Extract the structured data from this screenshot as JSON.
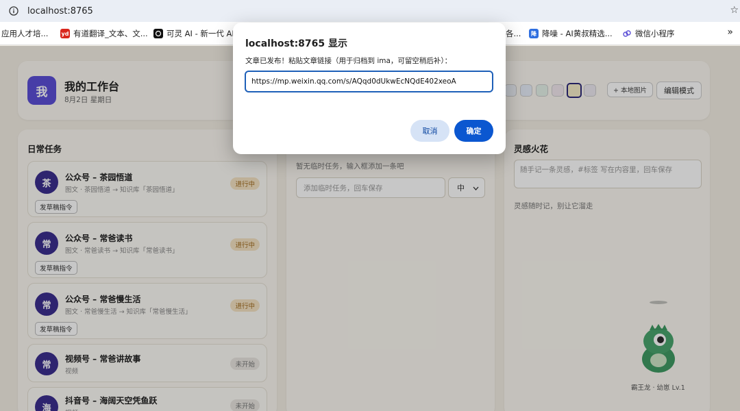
{
  "browser": {
    "url": "localhost:8765",
    "bookmarks": [
      {
        "label": "应用人才培...",
        "icon": "none"
      },
      {
        "label": "有道翻译_文本、文...",
        "icon": "youdao-icon",
        "badge": "yd"
      },
      {
        "label": "可灵 AI - 新一代 AI...",
        "icon": "kling-icon"
      },
      {
        "label": "各...",
        "icon": "none"
      },
      {
        "label": "降噪 - AI黄叔精选...",
        "icon": "jiangzao-icon",
        "badge": "降"
      },
      {
        "label": "微信小程序",
        "icon": "miniprogram-icon"
      }
    ],
    "more": "»"
  },
  "header": {
    "logo": "我",
    "title": "我的工作台",
    "date": "8月2日 星期日",
    "swatches": [
      "#eef1f8",
      "#e7eef9",
      "#e6f2ea",
      "#f2e8ef",
      "#f6edc9",
      "#eeeaf1"
    ],
    "local_image": "+ 本地图片",
    "edit_mode": "编辑模式"
  },
  "daily": {
    "title": "日常任务",
    "tasks": [
      {
        "avatar": "茶",
        "title": "公众号 – 茶园悟道",
        "sub": "图文 · 茶园悟道 → 知识库「茶园悟道」",
        "status": "进行中",
        "status_type": "doing",
        "cmd": "发草稿指令"
      },
      {
        "avatar": "常",
        "title": "公众号 – 常爸读书",
        "sub": "图文 · 常爸读书 → 知识库「常爸读书」",
        "status": "进行中",
        "status_type": "doing",
        "cmd": "发草稿指令"
      },
      {
        "avatar": "常",
        "title": "公众号 – 常爸慢生活",
        "sub": "图文 · 常爸慢生活 → 知识库「常爸慢生活」",
        "status": "进行中",
        "status_type": "doing",
        "cmd": "发草稿指令"
      },
      {
        "avatar": "常",
        "title": "视频号 – 常爸讲故事",
        "sub": "视频",
        "status": "未开始",
        "status_type": "todo",
        "cmd": ""
      },
      {
        "avatar": "海",
        "title": "抖音号 – 海阔天空凭鱼跃",
        "sub": "视频",
        "status": "未开始",
        "status_type": "todo",
        "cmd": ""
      }
    ]
  },
  "temp": {
    "empty": "暂无临时任务，输入框添加一条吧",
    "input_placeholder": "添加临时任务，回车保存",
    "priority": "中"
  },
  "spark": {
    "title": "灵感火花",
    "input_placeholder": "随手记一条灵感，#标签 写在内容里，回车保存",
    "empty": "灵感随时记，别让它溜走"
  },
  "pet": {
    "label": "霸王龙 · 幼崽 Lv.1",
    "color": "#3f9a63"
  },
  "dialog": {
    "title": "localhost:8765 显示",
    "message": "文章已发布！粘贴文章链接（用于归档到 ima，可留空稍后补）：",
    "value": "https://mp.weixin.qq.com/s/AQqd0dUkwEcNQdE402xeoA",
    "cancel": "取消",
    "ok": "确定",
    "accent": "#0b57d0"
  }
}
